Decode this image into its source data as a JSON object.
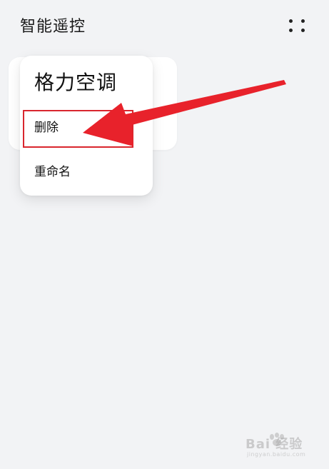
{
  "header": {
    "title": "智能遥控",
    "more_icon": "more-dots-icon"
  },
  "popup": {
    "device_name": "格力空调",
    "menu": [
      {
        "label": "删除"
      },
      {
        "label": "重命名"
      }
    ]
  },
  "annotation": {
    "highlight_color": "#d9262e",
    "arrow_color": "#e8222b"
  },
  "watermark": {
    "text": "Bai 经验",
    "url": "jingyan.baidu.com"
  }
}
